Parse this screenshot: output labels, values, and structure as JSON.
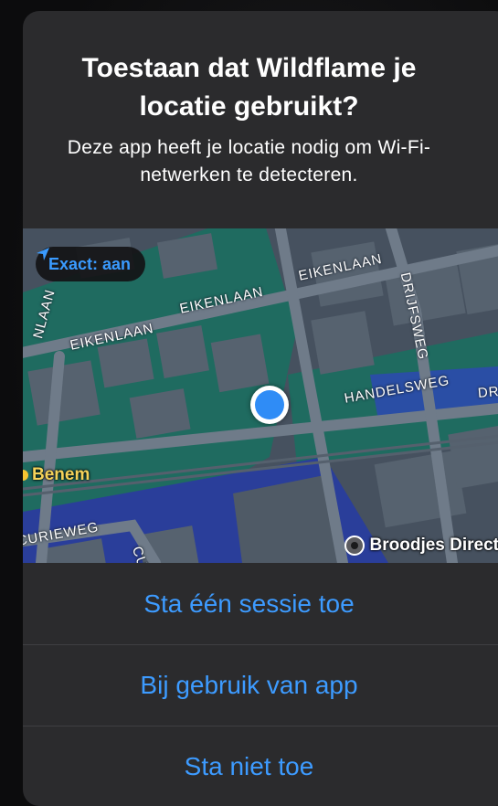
{
  "dialog": {
    "title": "Toestaan dat Wildflame je locatie gebruikt?",
    "message": "Deze app heeft je locatie nodig om Wi-Fi-netwerken te detecteren."
  },
  "map": {
    "precise_badge": "Exact: aan",
    "streets": {
      "eikenlaan_left": "EIKENLAAN",
      "eikenlaan_mid": "EIKENLAAN",
      "eikenlaan_top": "EIKENLAAN",
      "eikenlaan_edge": "NLAAN",
      "drijfsweg": "DRIJFSWEG",
      "handelsweg": "HANDELSWEG",
      "dr_edge": "DR",
      "curieweg": "CURIEWEG",
      "cur_edge": "CUR"
    },
    "poi": {
      "benem": "Benem",
      "broodjes": "Broodjes Direct"
    },
    "colors": {
      "land": "#46515f",
      "park": "#1f6b60",
      "water_park": "#2a4ea5",
      "road": "#697583",
      "building": "#56626f",
      "user_dot": "#2f8cf6",
      "accent": "#3d9bff"
    }
  },
  "actions": {
    "once": "Sta één sessie toe",
    "while_using": "Bij gebruik van app",
    "deny": "Sta niet toe"
  }
}
